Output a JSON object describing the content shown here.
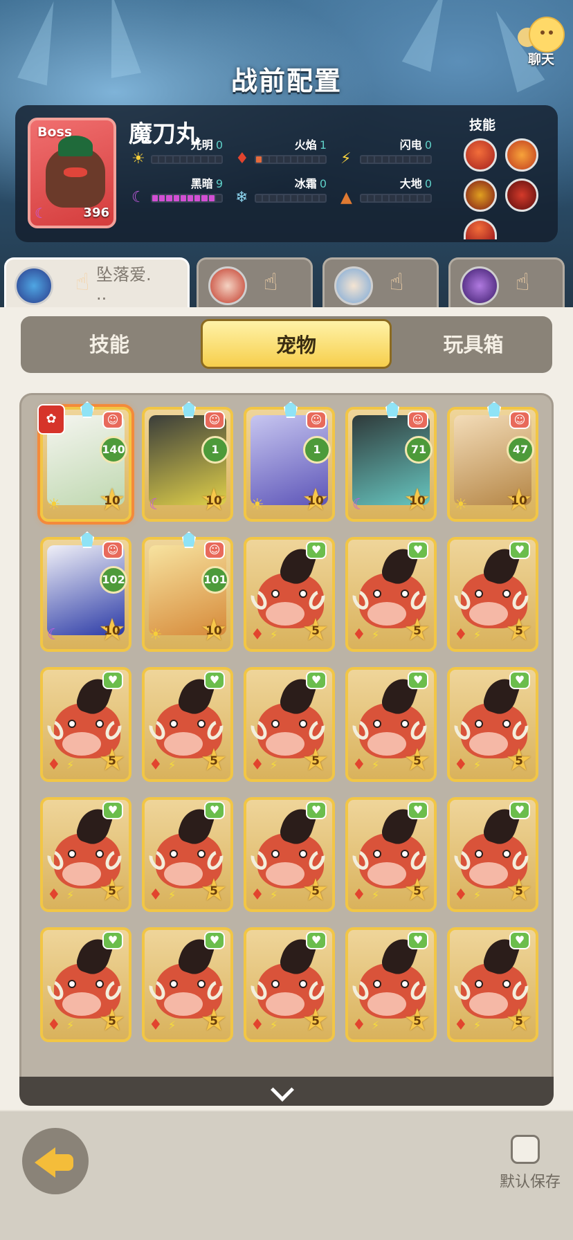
{
  "header": {
    "title": "战前配置",
    "chat_label": "聊天"
  },
  "boss": {
    "tag": "Boss",
    "name": "魔刀丸",
    "level": "396",
    "stats": [
      {
        "label": "光明",
        "value": "0",
        "icon": "☀",
        "filled": 0
      },
      {
        "label": "火焰",
        "value": "1",
        "icon": "🔥",
        "filled": 1
      },
      {
        "label": "闪电",
        "value": "0",
        "icon": "⚡",
        "filled": 0
      },
      {
        "label": "黑暗",
        "value": "9",
        "icon": "☾",
        "filled": 9
      },
      {
        "label": "冰霜",
        "value": "0",
        "icon": "❄",
        "filled": 0
      },
      {
        "label": "大地",
        "value": "0",
        "icon": "▲",
        "filled": 0
      }
    ],
    "skills_label": "技能"
  },
  "players": [
    {
      "name": "坠落爱.\n..",
      "active": true
    },
    {
      "name": "",
      "active": false
    },
    {
      "name": "",
      "active": false
    },
    {
      "name": "",
      "active": false
    }
  ],
  "segments": {
    "skills": "技能",
    "pets": "宠物",
    "toybox": "玩具箱",
    "active": "pets"
  },
  "pets": [
    {
      "kind": "panda",
      "level": "140",
      "star": "10",
      "elem": "☀",
      "selected": true,
      "favorite": true
    },
    {
      "kind": "dragon",
      "level": "1",
      "star": "10",
      "elem": "☾"
    },
    {
      "kind": "wolf",
      "level": "1",
      "star": "10",
      "elem": "☀"
    },
    {
      "kind": "beast",
      "level": "71",
      "star": "10",
      "elem": "☾"
    },
    {
      "kind": "cat",
      "level": "47",
      "star": "10",
      "elem": "☀"
    },
    {
      "kind": "knight",
      "level": "102",
      "star": "10",
      "elem": "☾"
    },
    {
      "kind": "dog",
      "level": "101",
      "star": "10",
      "elem": "☀"
    },
    {
      "kind": "boar",
      "star": "5"
    },
    {
      "kind": "boar",
      "star": "5"
    },
    {
      "kind": "boar",
      "star": "5"
    },
    {
      "kind": "boar",
      "star": "5"
    },
    {
      "kind": "boar",
      "star": "5"
    },
    {
      "kind": "boar",
      "star": "5"
    },
    {
      "kind": "boar",
      "star": "5"
    },
    {
      "kind": "boar",
      "star": "5"
    },
    {
      "kind": "boar",
      "star": "5"
    },
    {
      "kind": "boar",
      "star": "5"
    },
    {
      "kind": "boar",
      "star": "5"
    },
    {
      "kind": "boar",
      "star": "5"
    },
    {
      "kind": "boar",
      "star": "5"
    },
    {
      "kind": "boar",
      "star": "5"
    },
    {
      "kind": "boar",
      "star": "5"
    },
    {
      "kind": "boar",
      "star": "5"
    },
    {
      "kind": "boar",
      "star": "5"
    },
    {
      "kind": "boar",
      "star": "5"
    }
  ],
  "footer": {
    "save_label": "默认保存"
  },
  "icons": {
    "fire": "fire-icon",
    "lightning": "lightning-icon",
    "heart": "heart-badge-icon",
    "demon": "demon-badge-icon",
    "paw": "paw-icon"
  }
}
